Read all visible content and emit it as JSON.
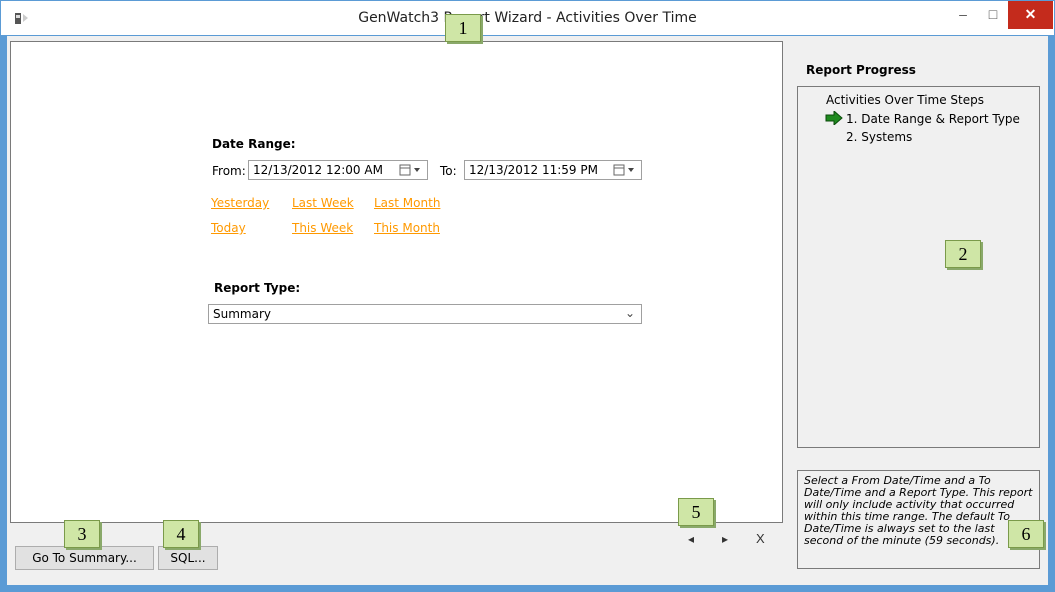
{
  "window": {
    "title": "GenWatch3 Report Wizard - Activities Over Time",
    "minimize_glyph": "–",
    "maximize_glyph": "□",
    "close_glyph": "✕"
  },
  "date_range": {
    "label": "Date Range:",
    "from_label": "From:",
    "from_value": "12/13/2012 12:00 AM",
    "to_label": "To:",
    "to_value": "12/13/2012 11:59 PM",
    "quick_links": [
      "Yesterday",
      "Last Week",
      "Last Month",
      "Today",
      "This Week",
      "This Month"
    ]
  },
  "report_type": {
    "label": "Report Type:",
    "selected": "Summary"
  },
  "progress": {
    "title": "Report Progress",
    "root": "Activities Over Time Steps",
    "steps": [
      "1. Date Range & Report Type",
      "2. Systems"
    ]
  },
  "help_text": "Select a From Date/Time and a To Date/Time and a Report Type.  This report will only include activity that occurred within this time range.  The default To Date/Time is always set to the last second of the minute (59 seconds).",
  "buttons": {
    "go_to_summary": "Go To Summary...",
    "sql": "SQL...",
    "prev": "◂",
    "next": "▸",
    "cancel": "X"
  },
  "badges": [
    "1",
    "2",
    "3",
    "4",
    "5",
    "6"
  ],
  "colors": {
    "link": "#ff9900",
    "close_button": "#c42b1c",
    "badge": "#cfe6a6"
  }
}
